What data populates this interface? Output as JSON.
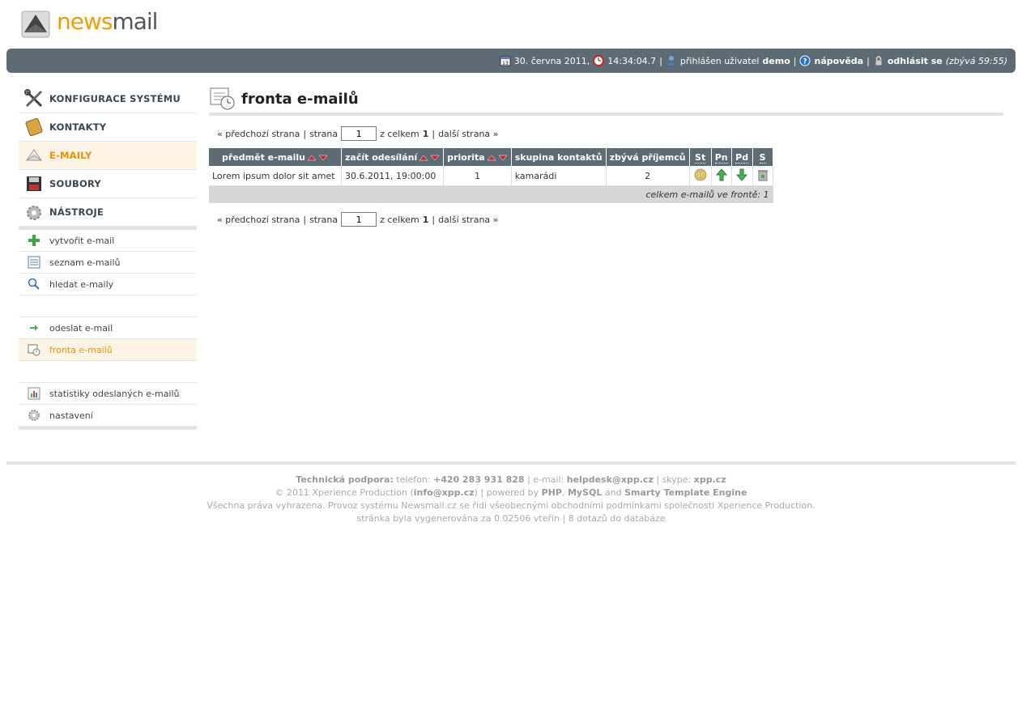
{
  "logo": {
    "brand_a": "news",
    "brand_b": "mail"
  },
  "topbar": {
    "date": "30. června 2011,",
    "time": "14:34:04.7",
    "sep": "|",
    "logged_label": "přihlášen uživatel",
    "user": "demo",
    "help": "nápověda",
    "logout": "odhlásit se",
    "remaining": "(zbývá 59:55)"
  },
  "sidebar": {
    "main": [
      {
        "label": "KONFIGURACE SYSTÉMU",
        "icon": "tools-icon"
      },
      {
        "label": "KONTAKTY",
        "icon": "address-book-icon"
      },
      {
        "label": "E-MAILY",
        "icon": "envelope-icon"
      },
      {
        "label": "SOUBORY",
        "icon": "floppy-icon"
      },
      {
        "label": "NÁSTROJE",
        "icon": "gears-icon"
      }
    ],
    "sub1": [
      {
        "label": "vytvořit e-mail",
        "icon": "plus-icon"
      },
      {
        "label": "seznam e-mailů",
        "icon": "list-icon"
      },
      {
        "label": "hledat e-maily",
        "icon": "search-icon"
      }
    ],
    "sub2": [
      {
        "label": "odeslat e-mail",
        "icon": "arrow-right-icon"
      },
      {
        "label": "fronta e-mailů",
        "icon": "queue-icon"
      }
    ],
    "sub3": [
      {
        "label": "statistiky odeslaných e-mailů",
        "icon": "stats-icon"
      },
      {
        "label": "nastavení",
        "icon": "gear-icon"
      }
    ]
  },
  "page": {
    "title": "fronta e-mailů"
  },
  "pager": {
    "prev": "« předchozí strana",
    "sep": "|",
    "page_label": "strana",
    "page_value": "1",
    "total_prefix": "z celkem",
    "total": "1",
    "next": "další strana »"
  },
  "table": {
    "headers": [
      "předmět e-mailu",
      "začít odesílání",
      "priorita",
      "skupina kontaktů",
      "zbývá příjemců",
      "St",
      "Pn",
      "Pd",
      "S"
    ],
    "rows": [
      {
        "subject": "Lorem ipsum dolor sit amet",
        "start": "30.6.2011, 19:00:00",
        "priority": "1",
        "group": "kamarádi",
        "remaining": "2"
      }
    ],
    "footer": "celkem e-mailů ve frontě: 1"
  },
  "footer": {
    "line1_label": "Technická podpora:",
    "line1_phone_label": "telefon:",
    "line1_phone": "+420 283 931 828",
    "line1_email_label": "| e-mail:",
    "line1_email": "helpdesk@xpp.cz",
    "line1_skype_label": "| skype:",
    "line1_skype": "xpp.cz",
    "line2_a": "© 2011 Xperience Production (",
    "line2_email": "info@xpp.cz",
    "line2_b": ") | powered by",
    "line2_php": "PHP",
    "line2_comma": ",",
    "line2_mysql": "MySQL",
    "line2_and": "and",
    "line2_smarty": "Smarty Template Engine",
    "line3": "Všechna práva vyhrazena. Provoz systému Newsmail.cz se řídí všeobecnými obchodními podmínkami společnosti Xperience Production.",
    "line4": "stránka byla vygenerována za 0.02506 vteřin | 8 dotazů do databáze"
  },
  "colors": {
    "bar": "#5d6b74",
    "accent": "#e8900c",
    "active_bg": "#fdf4e6"
  }
}
